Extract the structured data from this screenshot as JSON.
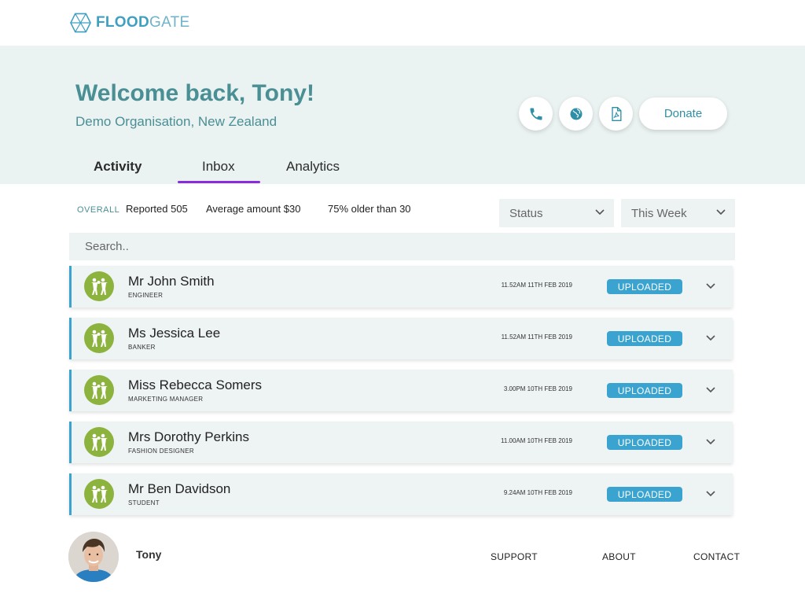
{
  "brand": {
    "name_bold": "FLOOD",
    "name_light": "GATE",
    "accent_color": "#3aa3cf",
    "tab_indicator_color": "#8a2be2"
  },
  "hero": {
    "welcome": "Welcome back, Tony!",
    "organisation": "Demo Organisation, New Zealand",
    "icons": [
      "phone-icon",
      "globe-icon",
      "pdf-icon"
    ],
    "donate_label": "Donate"
  },
  "tabs": [
    {
      "label": "Activity"
    },
    {
      "label": "Inbox",
      "active": true
    },
    {
      "label": "Analytics"
    }
  ],
  "stats": {
    "overall_label": "OVERALL",
    "reported": "Reported 505",
    "average": "Average amount $30",
    "older": "75% older than 30"
  },
  "filters": {
    "status": "Status",
    "period": "This Week"
  },
  "search": {
    "placeholder": "Search.."
  },
  "rows": [
    {
      "name": "Mr John Smith",
      "role": "ENGINEER",
      "time": "11.52AM 11TH FEB 2019",
      "status": "UPLOADED"
    },
    {
      "name": "Ms Jessica Lee",
      "role": "BANKER",
      "time": "11.52AM 11TH FEB 2019",
      "status": "UPLOADED"
    },
    {
      "name": "Miss Rebecca Somers",
      "role": "MARKETING MANAGER",
      "time": "3.00PM 10TH FEB 2019",
      "status": "UPLOADED"
    },
    {
      "name": "Mrs Dorothy Perkins",
      "role": "FASHION DESIGNER",
      "time": "11.00AM 10TH FEB 2019",
      "status": "UPLOADED"
    },
    {
      "name": "Mr Ben Davidson",
      "role": "STUDENT",
      "time": "9.24AM 10TH FEB 2019",
      "status": "UPLOADED"
    }
  ],
  "footer": {
    "user_name": "Tony",
    "links": [
      "SUPPORT",
      "ABOUT",
      "CONTACT"
    ]
  }
}
